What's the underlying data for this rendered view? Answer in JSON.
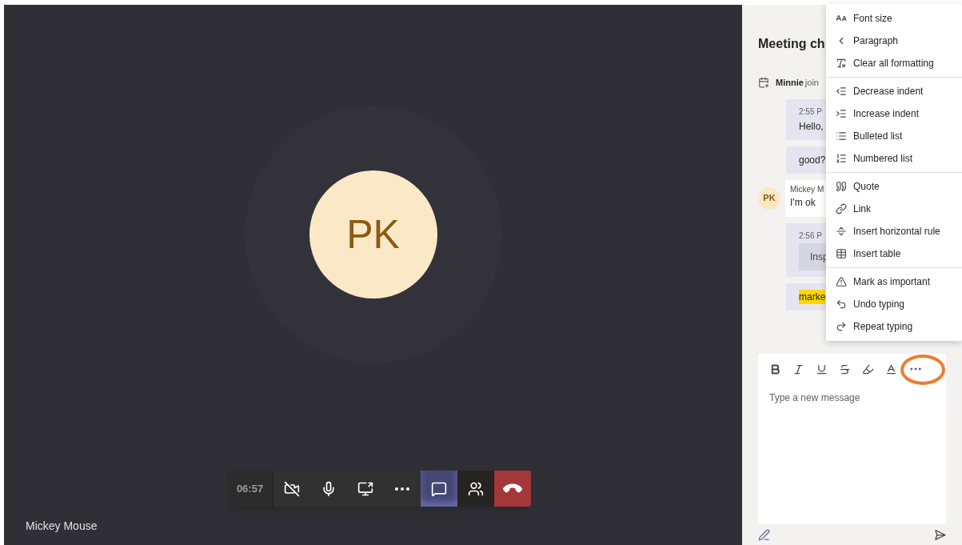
{
  "stage": {
    "avatar_initials": "PK",
    "participant_name": "Mickey Mouse"
  },
  "call_controls": [
    {
      "kind": "timer",
      "label": "06:57"
    },
    {
      "kind": "camera",
      "selected": false
    },
    {
      "kind": "mic",
      "selected": false
    },
    {
      "kind": "share",
      "selected": false
    },
    {
      "kind": "more",
      "selected": false
    },
    {
      "kind": "chat",
      "selected": true
    },
    {
      "kind": "people",
      "selected": false
    },
    {
      "kind": "hangup"
    }
  ],
  "chat": {
    "title": "Meeting ch",
    "event": {
      "name": "Minnie",
      "text": "join"
    },
    "messages": [
      {
        "kind": "mine",
        "time": "2:55 P",
        "text": "Hello,"
      },
      {
        "kind": "mine",
        "text": "good?"
      },
      {
        "kind": "theirs",
        "initials": "PK",
        "sender": "Mickey M",
        "text": "I'm ok"
      },
      {
        "kind": "mine",
        "time": "2:56 P",
        "quote": "Insp"
      },
      {
        "kind": "mine",
        "highlight": "marke"
      }
    ],
    "format_menu": [
      [
        {
          "label": "Font size"
        },
        {
          "label": "Paragraph"
        },
        {
          "label": "Clear all formatting"
        }
      ],
      [
        {
          "label": "Decrease indent"
        },
        {
          "label": "Increase indent"
        },
        {
          "label": "Bulleted list"
        },
        {
          "label": "Numbered list"
        }
      ],
      [
        {
          "label": "Quote"
        },
        {
          "label": "Link"
        },
        {
          "label": "Insert horizontal rule"
        },
        {
          "label": "Insert table"
        }
      ],
      [
        {
          "label": "Mark as important"
        },
        {
          "label": "Undo typing"
        },
        {
          "label": "Repeat typing"
        }
      ]
    ],
    "compose": {
      "placeholder": "Type a new message",
      "more_highlighted": true
    }
  }
}
